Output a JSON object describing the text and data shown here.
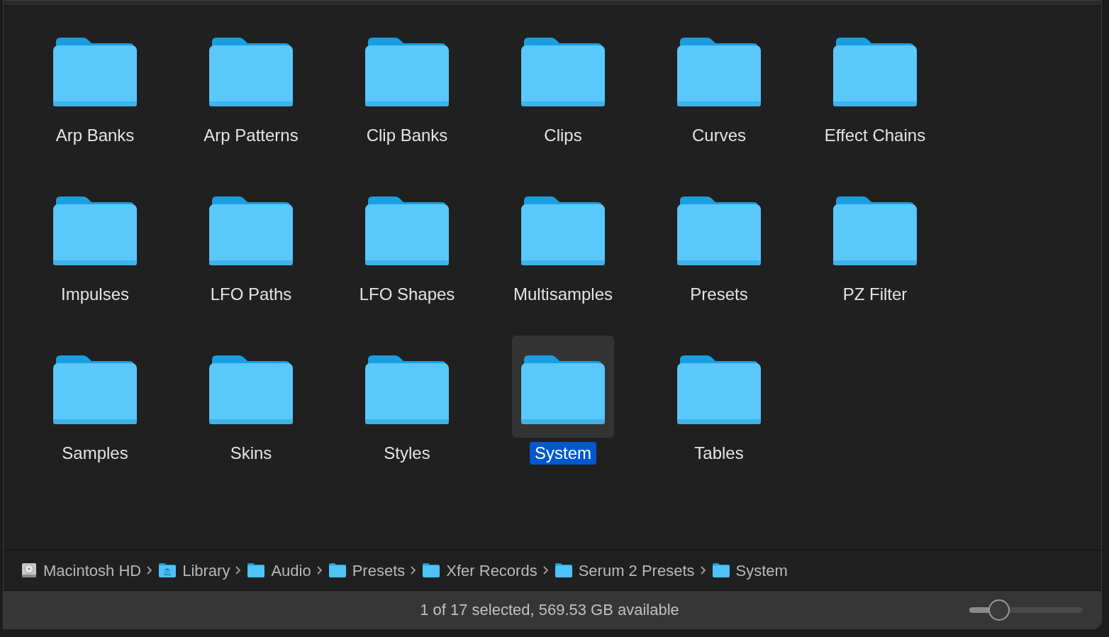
{
  "folders": [
    {
      "name": "Arp Banks",
      "selected": false
    },
    {
      "name": "Arp Patterns",
      "selected": false
    },
    {
      "name": "Clip Banks",
      "selected": false
    },
    {
      "name": "Clips",
      "selected": false
    },
    {
      "name": "Curves",
      "selected": false
    },
    {
      "name": "Effect Chains",
      "selected": false
    },
    {
      "name": "Impulses",
      "selected": false
    },
    {
      "name": "LFO Paths",
      "selected": false
    },
    {
      "name": "LFO Shapes",
      "selected": false
    },
    {
      "name": "Multisamples",
      "selected": false
    },
    {
      "name": "Presets",
      "selected": false
    },
    {
      "name": "PZ Filter",
      "selected": false
    },
    {
      "name": "Samples",
      "selected": false
    },
    {
      "name": "Skins",
      "selected": false
    },
    {
      "name": "Styles",
      "selected": false
    },
    {
      "name": "System",
      "selected": true
    },
    {
      "name": "Tables",
      "selected": false
    }
  ],
  "path_bar": [
    {
      "name": "Macintosh HD",
      "kind": "disk"
    },
    {
      "name": "Library",
      "kind": "library"
    },
    {
      "name": "Audio",
      "kind": "folder"
    },
    {
      "name": "Presets",
      "kind": "folder"
    },
    {
      "name": "Xfer Records",
      "kind": "folder"
    },
    {
      "name": "Serum 2 Presets",
      "kind": "folder"
    },
    {
      "name": "System",
      "kind": "folder"
    }
  ],
  "status_bar": {
    "text": "1 of 17 selected, 569.53 GB available",
    "icon_size": {
      "level": 0.26
    }
  }
}
